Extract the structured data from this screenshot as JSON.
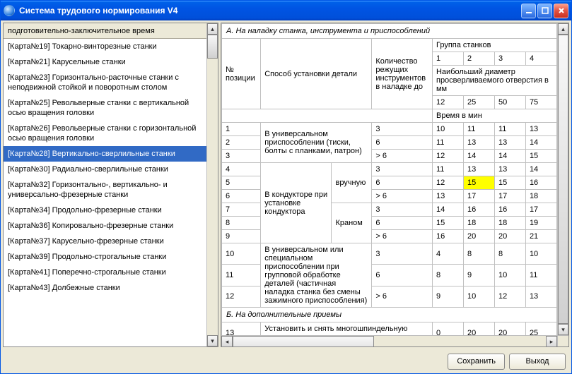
{
  "window": {
    "title": "Система трудового нормирования V4"
  },
  "sidebar": {
    "header": "подготовительно-заключительное время",
    "items": [
      {
        "label": "[Карта№19] Токарно-винторезные станки"
      },
      {
        "label": "[Карта№21] Карусельные станки"
      },
      {
        "label": "[Карта№23] Горизонтально-расточные станки с неподвижной стойкой и поворотным столом"
      },
      {
        "label": "[Карта№25] Револьверные станки с вертикальной осью вращения головки"
      },
      {
        "label": "[Карта№26] Револьверные станки с горизонтальной осью вращения головки"
      },
      {
        "label": "[Карта№28] Вертикально-сверлильные станки",
        "selected": true
      },
      {
        "label": "[Карта№30] Радиально-сверлильные станки"
      },
      {
        "label": "[Карта№32] Горизонтально-, вертикально- и универсально-фрезерные станки"
      },
      {
        "label": "[Карта№34] Продольно-фрезерные станки"
      },
      {
        "label": "[Карта№36] Копировально-фрезерные станки"
      },
      {
        "label": "[Карта№37] Карусельно-фрезерные станки"
      },
      {
        "label": "[Карта№39] Продольно-строгальные станки"
      },
      {
        "label": "[Карта№41] Поперечно-строгальные станки"
      },
      {
        "label": "[Карта№43] Долбежные станки"
      }
    ]
  },
  "table": {
    "section_a": "А. На наладку станка, инструмента и приспособлений",
    "section_b": "Б. На дополнительные приемы",
    "head": {
      "pos": "№ позиции",
      "method": "Способ установки детали",
      "qty": "Количество режущих инструментов в наладке до",
      "group": "Группа станков",
      "group_nums": [
        "1",
        "2",
        "3",
        "4"
      ],
      "diameter": "Наибольший диаметр просверливаемого отверстия в мм",
      "diam_vals": [
        "12",
        "25",
        "50",
        "75"
      ],
      "time": "Время в мин"
    },
    "body": {
      "g1": {
        "pos": [
          "1",
          "2",
          "3"
        ],
        "method": "В универсальном приспособлении (тиски, болты с планками, патрон)",
        "qty": [
          "3",
          "6",
          "> 6"
        ],
        "vals": [
          [
            "10",
            "11",
            "11",
            "13"
          ],
          [
            "11",
            "13",
            "13",
            "14"
          ],
          [
            "12",
            "14",
            "14",
            "15"
          ]
        ]
      },
      "g2": {
        "pos": [
          "4",
          "5",
          "6"
        ],
        "method": "В кондукторе при установке кондуктора",
        "sub": "вручную",
        "qty": [
          "3",
          "6",
          "> 6"
        ],
        "vals": [
          [
            "11",
            "13",
            "13",
            "14"
          ],
          [
            "12",
            "15",
            "15",
            "16"
          ],
          [
            "13",
            "17",
            "17",
            "18"
          ]
        ],
        "hl": {
          "row": 1,
          "col": 1
        }
      },
      "g3": {
        "pos": [
          "7",
          "8",
          "9"
        ],
        "sub": "Краном",
        "qty": [
          "3",
          "6",
          "> 6"
        ],
        "vals": [
          [
            "14",
            "16",
            "16",
            "17"
          ],
          [
            "15",
            "18",
            "18",
            "19"
          ],
          [
            "16",
            "20",
            "20",
            "21"
          ]
        ]
      },
      "g4": {
        "pos": [
          "10",
          "11",
          "12"
        ],
        "method": "В универсальном или специальном приспособлении при групповой обработке деталей (частичная наладка станка без смены зажимного приспособления)",
        "qty": [
          "3",
          "6",
          "> 6"
        ],
        "vals": [
          [
            "4",
            "8",
            "8",
            "10"
          ],
          [
            "8",
            "9",
            "10",
            "11"
          ],
          [
            "9",
            "10",
            "12",
            "13"
          ]
        ]
      },
      "r13": {
        "pos": "13",
        "method": "Установить и снять многошпиндельную головку",
        "vals": [
          "0",
          "20",
          "20",
          "25"
        ]
      }
    }
  },
  "footer": {
    "save": "Сохранить",
    "exit": "Выход"
  }
}
